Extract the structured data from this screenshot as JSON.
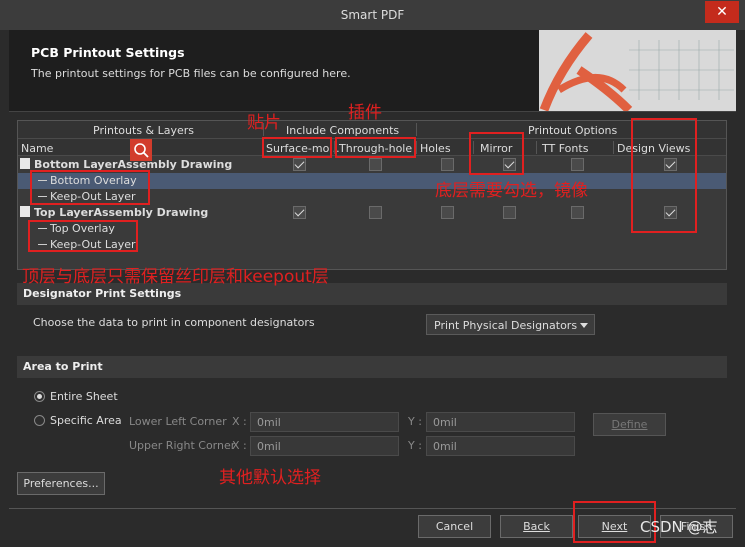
{
  "window": {
    "title": "Smart PDF",
    "close_glyph": "✕"
  },
  "banner": {
    "title": "PCB Printout Settings",
    "subtitle": "The printout settings for PCB files can be configured here."
  },
  "table": {
    "group_headers": {
      "printouts": "Printouts & Layers",
      "include": "Include Components",
      "options": "Printout Options"
    },
    "columns": [
      "Name",
      "Surface-mo...",
      "Through-hole",
      "Holes",
      "Mirror",
      "TT Fonts",
      "Design Views"
    ],
    "rows": [
      {
        "name": "Bottom LayerAssembly Drawing",
        "checks": [
          true,
          false,
          false,
          true,
          false,
          true
        ]
      },
      {
        "name": "Bottom Overlay"
      },
      {
        "name": "Keep-Out Layer"
      },
      {
        "name": "Top LayerAssembly Drawing",
        "checks": [
          true,
          false,
          false,
          false,
          false,
          true
        ]
      },
      {
        "name": "Top Overlay"
      },
      {
        "name": "Keep-Out Layer"
      }
    ]
  },
  "designator": {
    "section_title": "Designator Print Settings",
    "prompt": "Choose the data to print in component designators",
    "selected": "Print Physical Designators"
  },
  "area": {
    "section_title": "Area to Print",
    "entire_sheet": "Entire Sheet",
    "specific_area": "Specific Area",
    "lower_left": "Lower Left Corner",
    "upper_right": "Upper Right Corner",
    "x_label": "X :",
    "y_label": "Y :",
    "ll_x": "0mil",
    "ll_y": "0mil",
    "ur_x": "0mil",
    "ur_y": "0mil",
    "define_label": "Define"
  },
  "buttons": {
    "preferences": "Preferences...",
    "cancel": "Cancel",
    "back": "Back",
    "next": "Next",
    "finish": "Finish"
  },
  "annotations": {
    "smd": "贴片",
    "through": "插件",
    "mirror_note": "底层需要勾选，镜像",
    "layers_note": "顶层与底层只需保留丝印层和keepout层",
    "default_note": "其他默认选择",
    "watermark": "CSDN @志"
  },
  "colors": {
    "accent_red": "#e02020",
    "selection": "#4a5a74"
  }
}
